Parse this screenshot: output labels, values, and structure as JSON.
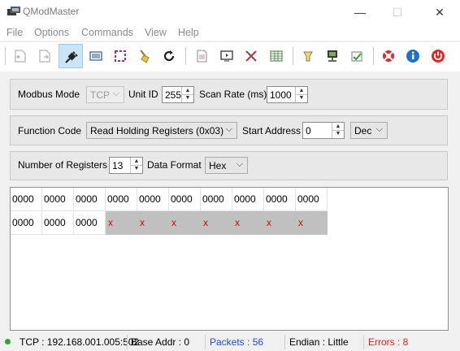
{
  "window": {
    "title": "QModMaster",
    "controls": {
      "minimize": "—",
      "maximize": "☐",
      "close": "✕"
    }
  },
  "menu": {
    "items": [
      "File",
      "Options",
      "Commands",
      "View",
      "Help"
    ]
  },
  "toolbar": {
    "buttons": [
      {
        "icon": "load-session-icon"
      },
      {
        "icon": "save-session-icon"
      },
      {
        "icon": "connect-plug-icon",
        "active": true
      },
      {
        "icon": "read-write-icon"
      },
      {
        "icon": "scan-icon"
      },
      {
        "icon": "clear-broom-icon"
      },
      {
        "icon": "reset-refresh-icon"
      },
      {
        "icon": "bus-monitor-icon"
      },
      {
        "icon": "modbus-monitor-icon"
      },
      {
        "icon": "tools-icon"
      },
      {
        "icon": "registers-table-icon"
      },
      {
        "icon": "modbus-rtu-icon"
      },
      {
        "icon": "modbus-tcp-icon"
      },
      {
        "icon": "settings-icon"
      },
      {
        "icon": "help-lifebuoy-icon"
      },
      {
        "icon": "about-info-icon"
      },
      {
        "icon": "exit-power-icon"
      }
    ]
  },
  "settings": {
    "modbus_mode_label": "Modbus Mode",
    "modbus_mode_value": "TCP",
    "unit_id_label": "Unit ID",
    "unit_id_value": "255",
    "scan_rate_label": "Scan Rate (ms)",
    "scan_rate_value": "1000",
    "function_code_label": "Function Code",
    "function_code_value": "Read Holding Registers (0x03)",
    "start_address_label": "Start Address",
    "start_address_value": "0",
    "address_format_value": "Dec",
    "num_registers_label": "Number of Registers",
    "num_registers_value": "13",
    "data_format_label": "Data Format",
    "data_format_value": "Hex"
  },
  "registers": {
    "rows": [
      [
        "0000",
        "0000",
        "0000",
        "0000",
        "0000",
        "0000",
        "0000",
        "0000",
        "0000",
        "0000"
      ],
      [
        "0000",
        "0000",
        "0000",
        "x",
        "x",
        "x",
        "x",
        "x",
        "x",
        "x"
      ]
    ],
    "empty_marker": "x"
  },
  "status": {
    "connection": "TCP : 192.168.001.005:502",
    "base_addr": "Base Addr : 0",
    "packets": "Packets : 56",
    "endian": "Endian : Little",
    "errors": "Errors : 8",
    "colors": {
      "packets": "#1f4fd0",
      "errors": "#d21f1f",
      "connected": "#2fa52f"
    }
  }
}
